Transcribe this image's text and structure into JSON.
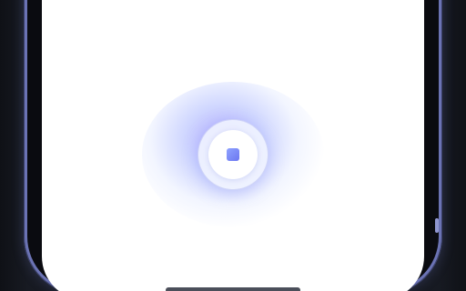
{
  "app": {
    "title": ""
  },
  "recorder": {
    "state": "recording",
    "control_icon": "stop-icon",
    "accent_color": "#7580f5",
    "glow_color": "#7a6eff"
  },
  "device": {
    "frame_color": "#6b73b4",
    "screen_color": "#ffffff"
  }
}
